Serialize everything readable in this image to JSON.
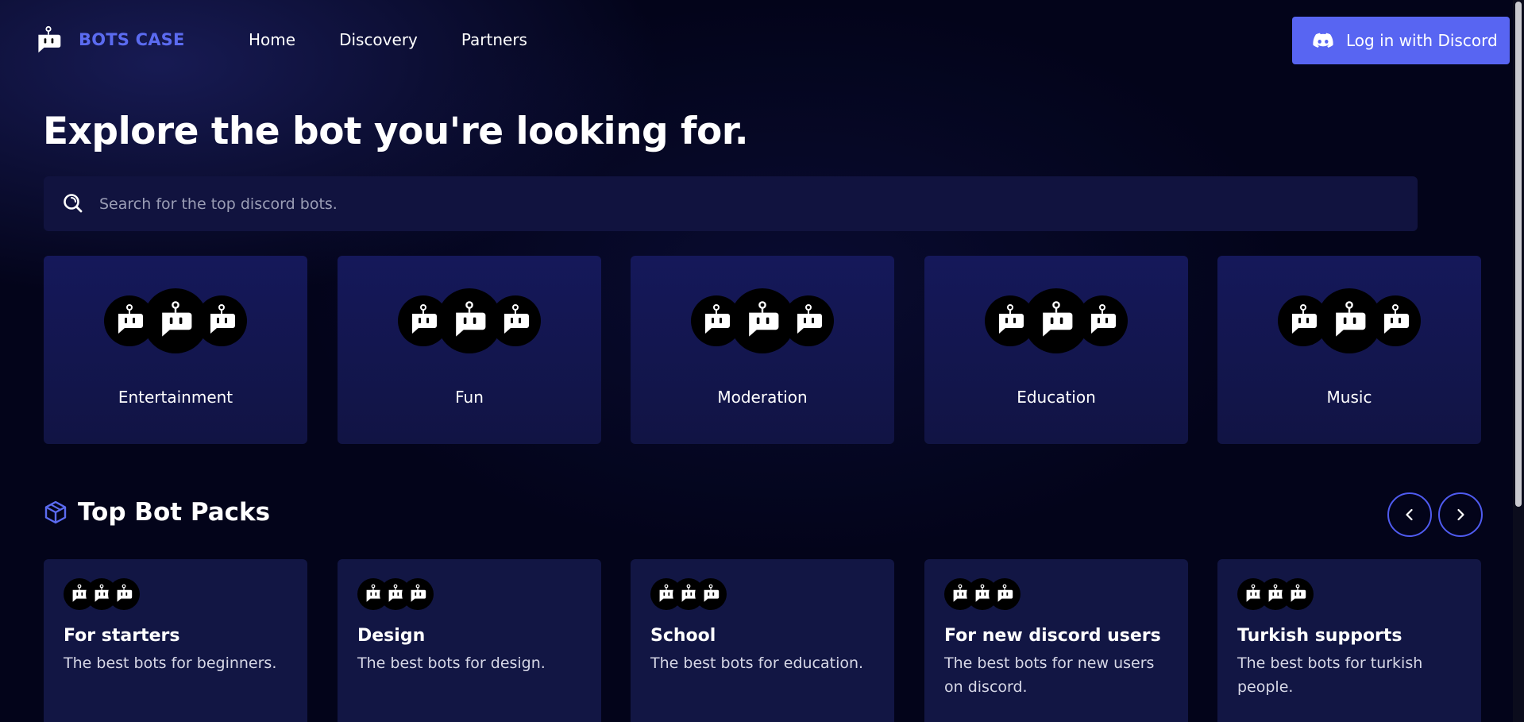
{
  "brand": {
    "name": "BOTS CASE"
  },
  "nav": [
    "Home",
    "Discovery",
    "Partners"
  ],
  "login": {
    "label": "Log in with Discord"
  },
  "hero": {
    "title": "Explore the bot you're looking for."
  },
  "search": {
    "placeholder": "Search for the top discord bots."
  },
  "categories": [
    "Entertainment",
    "Fun",
    "Moderation",
    "Education",
    "Music"
  ],
  "packs_section": {
    "title": "Top Bot Packs"
  },
  "packs": [
    {
      "name": "For starters",
      "desc": "The best bots for beginners."
    },
    {
      "name": "Design",
      "desc": "The best bots for design."
    },
    {
      "name": "School",
      "desc": "The best bots for education."
    },
    {
      "name": "For new discord users",
      "desc": "The best bots for new users on discord."
    },
    {
      "name": "Turkish supports",
      "desc": "The best bots for turkish people."
    }
  ],
  "icons": {
    "logo": "bot-logo-icon",
    "discord": "discord-icon",
    "search": "search-icon",
    "section": "cube-icon",
    "prev": "chevron-left-icon",
    "next": "chevron-right-icon",
    "bot": "bot-icon"
  },
  "colors": {
    "accent": "#5865f2",
    "brand": "#5b6bf0",
    "background": "#03041a",
    "card": "#15185a"
  }
}
